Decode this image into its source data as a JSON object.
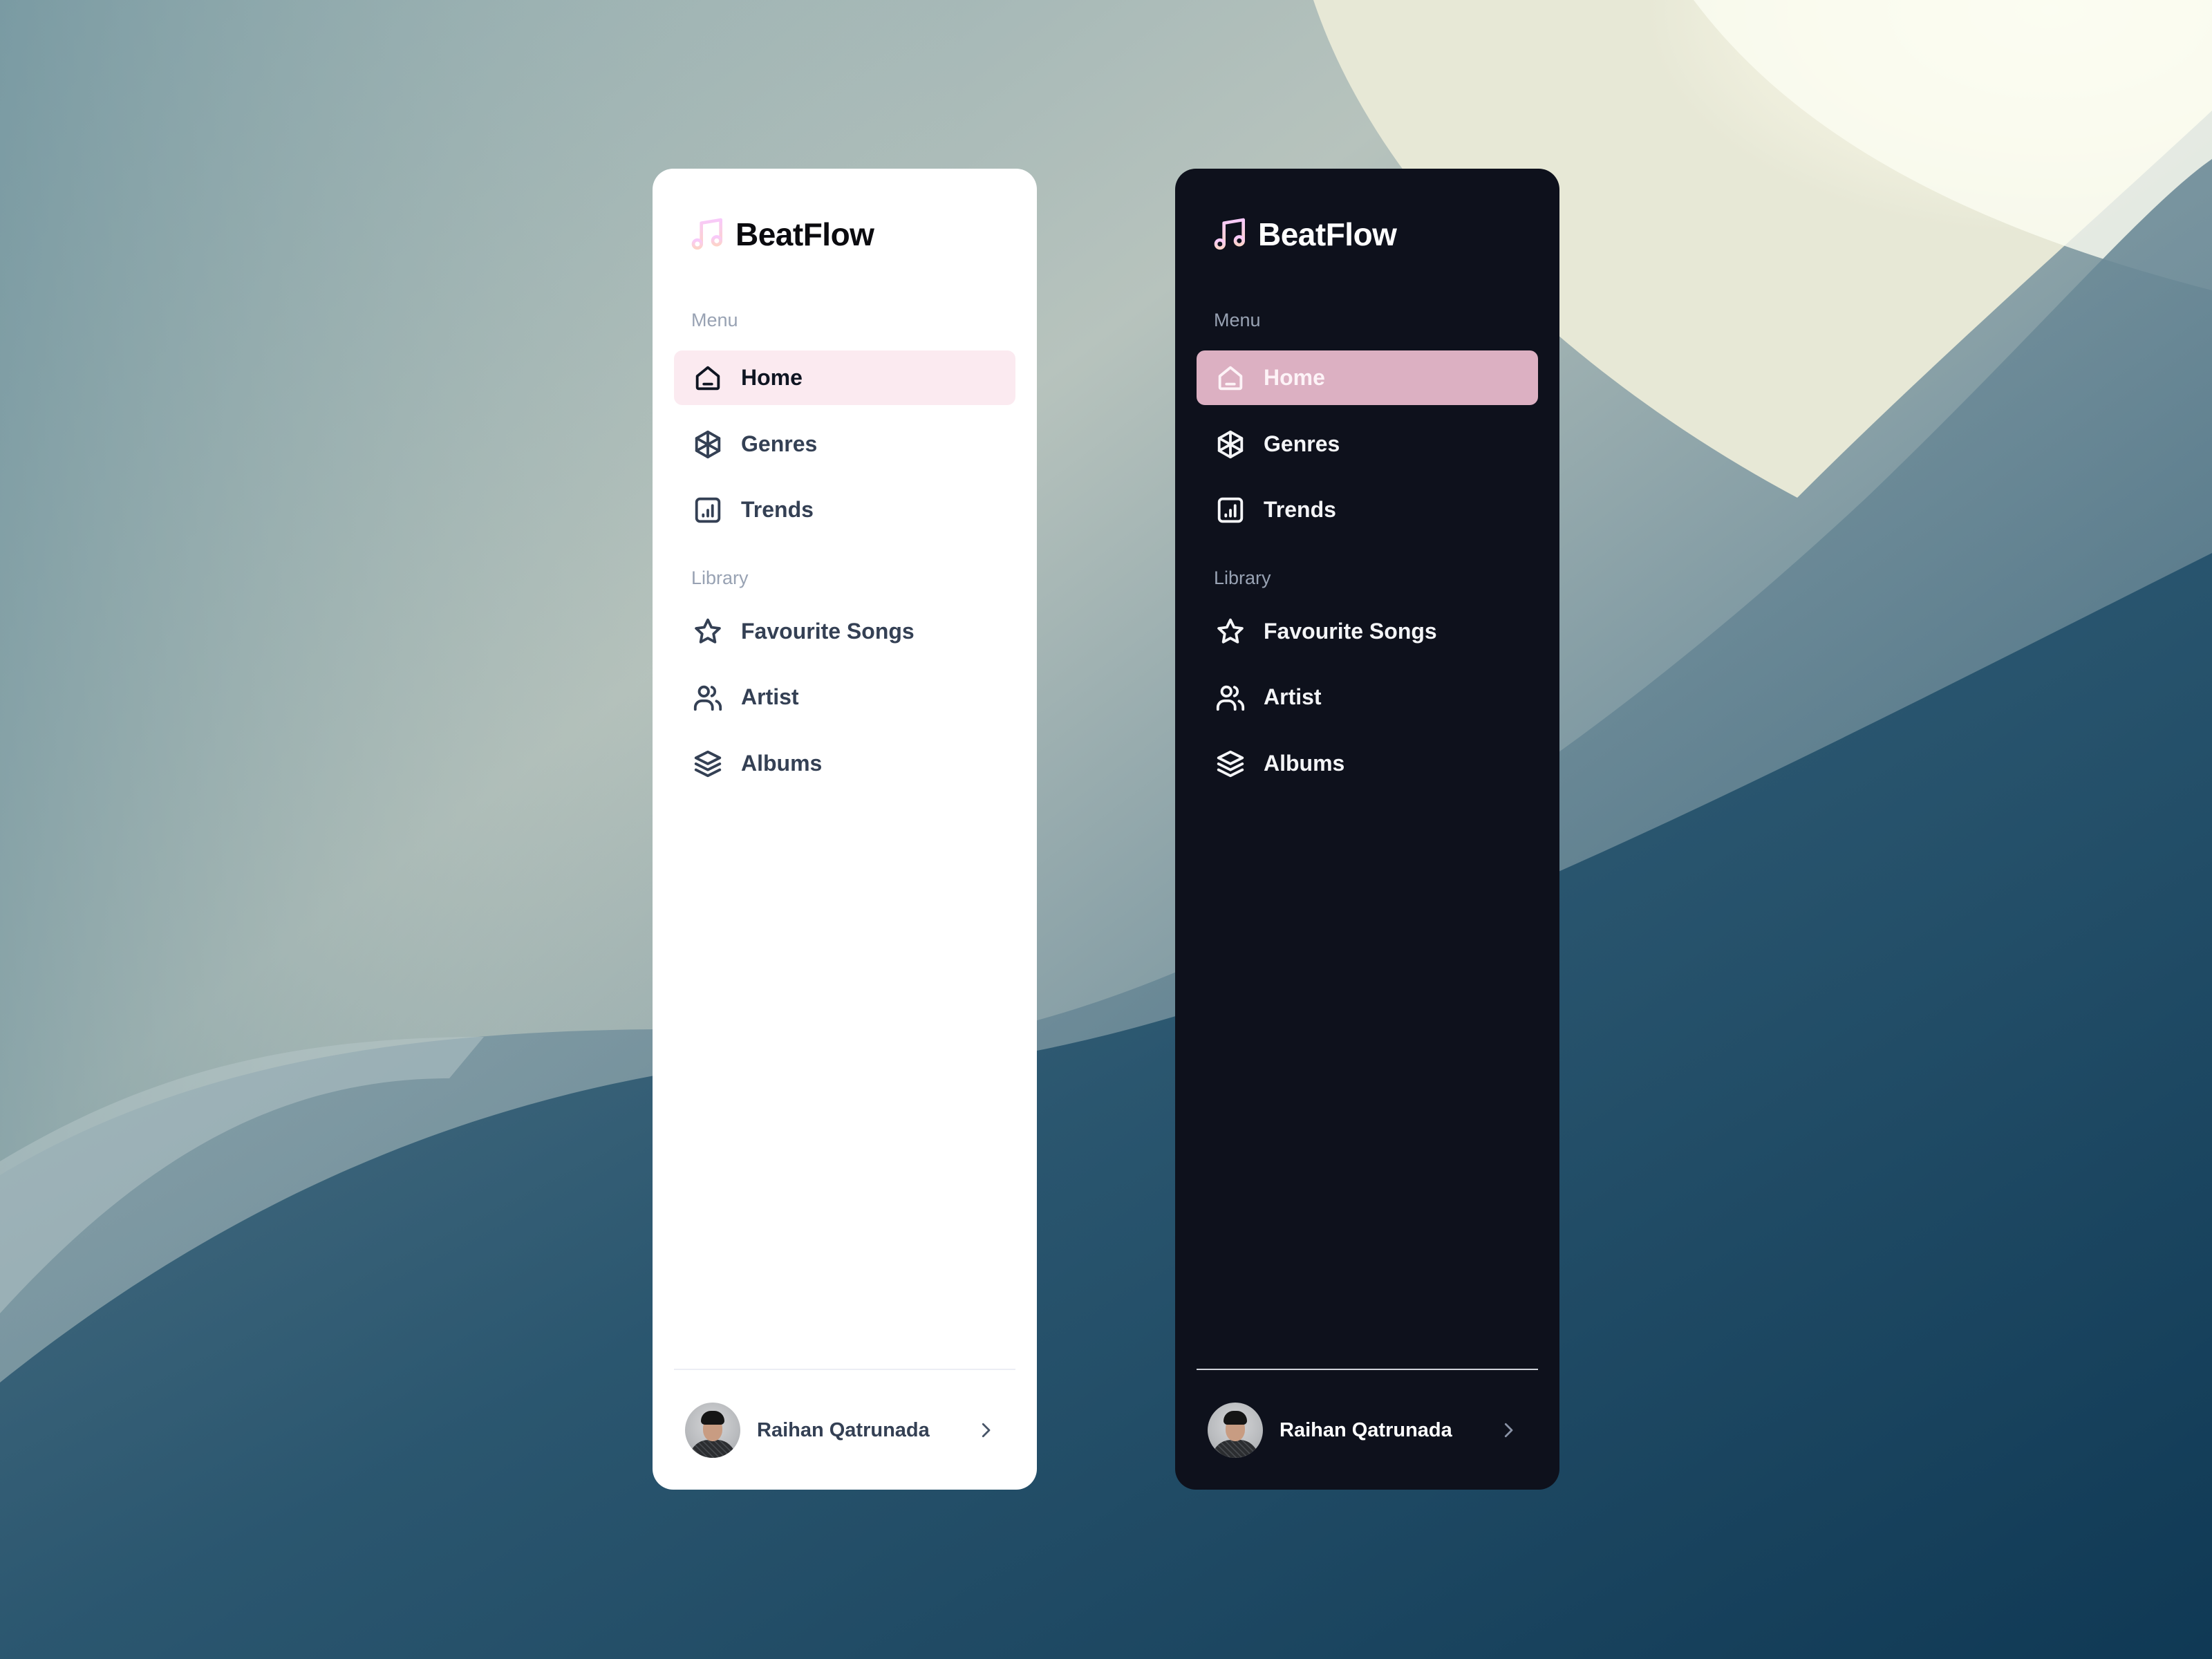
{
  "themes": [
    {
      "id": "light",
      "brand": {
        "name": "BeatFlow",
        "icon": "music-note-icon"
      },
      "sections": [
        {
          "label": "Menu",
          "items": [
            {
              "label": "Home",
              "icon": "home-icon",
              "active": true
            },
            {
              "label": "Genres",
              "icon": "genres-icon",
              "active": false
            },
            {
              "label": "Trends",
              "icon": "chart-icon",
              "active": false
            }
          ]
        },
        {
          "label": "Library",
          "items": [
            {
              "label": "Favourite Songs",
              "icon": "star-icon",
              "active": false
            },
            {
              "label": "Artist",
              "icon": "users-icon",
              "active": false
            },
            {
              "label": "Albums",
              "icon": "layers-icon",
              "active": false
            }
          ]
        }
      ],
      "user": {
        "name": "Raihan Qatrunada",
        "chevron": "chevron-right-icon"
      },
      "colors": {
        "card_bg": "#ffffff",
        "active_bg": "#fbeaf0",
        "text": "#344054",
        "muted": "#98a2b3"
      }
    },
    {
      "id": "dark",
      "brand": {
        "name": "BeatFlow",
        "icon": "music-note-icon"
      },
      "sections": [
        {
          "label": "Menu",
          "items": [
            {
              "label": "Home",
              "icon": "home-icon",
              "active": true
            },
            {
              "label": "Genres",
              "icon": "genres-icon",
              "active": false
            },
            {
              "label": "Trends",
              "icon": "chart-icon",
              "active": false
            }
          ]
        },
        {
          "label": "Library",
          "items": [
            {
              "label": "Favourite Songs",
              "icon": "star-icon",
              "active": false
            },
            {
              "label": "Artist",
              "icon": "users-icon",
              "active": false
            },
            {
              "label": "Albums",
              "icon": "layers-icon",
              "active": false
            }
          ]
        }
      ],
      "user": {
        "name": "Raihan Qatrunada",
        "chevron": "chevron-right-icon"
      },
      "colors": {
        "card_bg": "#0e111c",
        "active_bg": "#dcb0c2",
        "text": "#f4f5f7",
        "muted": "#98a2b3"
      }
    }
  ],
  "brand_gradient": [
    "#f8c9fa",
    "#fdd3c9"
  ]
}
